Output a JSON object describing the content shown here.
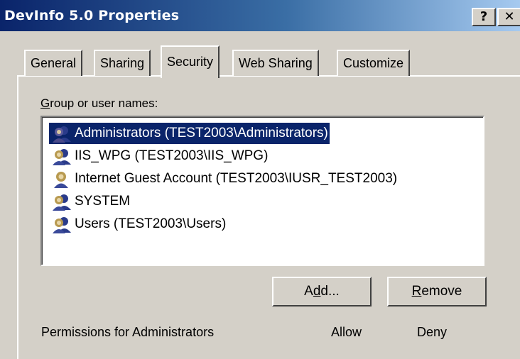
{
  "window": {
    "title": "DevInfo 5.0 Properties",
    "help_button": "?",
    "close_button": "✕"
  },
  "tabs": [
    {
      "label": "General"
    },
    {
      "label": "Sharing"
    },
    {
      "label": "Security",
      "active": true
    },
    {
      "label": "Web Sharing"
    },
    {
      "label": "Customize"
    }
  ],
  "group_label": {
    "mnemonic": "G",
    "rest": "roup or user names:"
  },
  "users": [
    {
      "label": "Administrators (TEST2003\\Administrators)",
      "selected": true,
      "icon": "group-icon"
    },
    {
      "label": "IIS_WPG (TEST2003\\IIS_WPG)",
      "icon": "group-icon"
    },
    {
      "label": "Internet Guest Account (TEST2003\\IUSR_TEST2003)",
      "icon": "user-icon"
    },
    {
      "label": "SYSTEM",
      "icon": "group-icon"
    },
    {
      "label": "Users (TEST2003\\Users)",
      "icon": "group-icon"
    }
  ],
  "buttons": {
    "add": {
      "pre": "A",
      "mnemonic": "d",
      "post": "d..."
    },
    "remove": {
      "mnemonic": "R",
      "post": "emove"
    }
  },
  "permissions": {
    "header": "Permissions for Administrators",
    "allow": "Allow",
    "deny": "Deny"
  },
  "colors": {
    "title_start": "#0a246a",
    "title_end": "#a6caf0",
    "selection": "#0a246a",
    "face": "#d4d0c8"
  }
}
